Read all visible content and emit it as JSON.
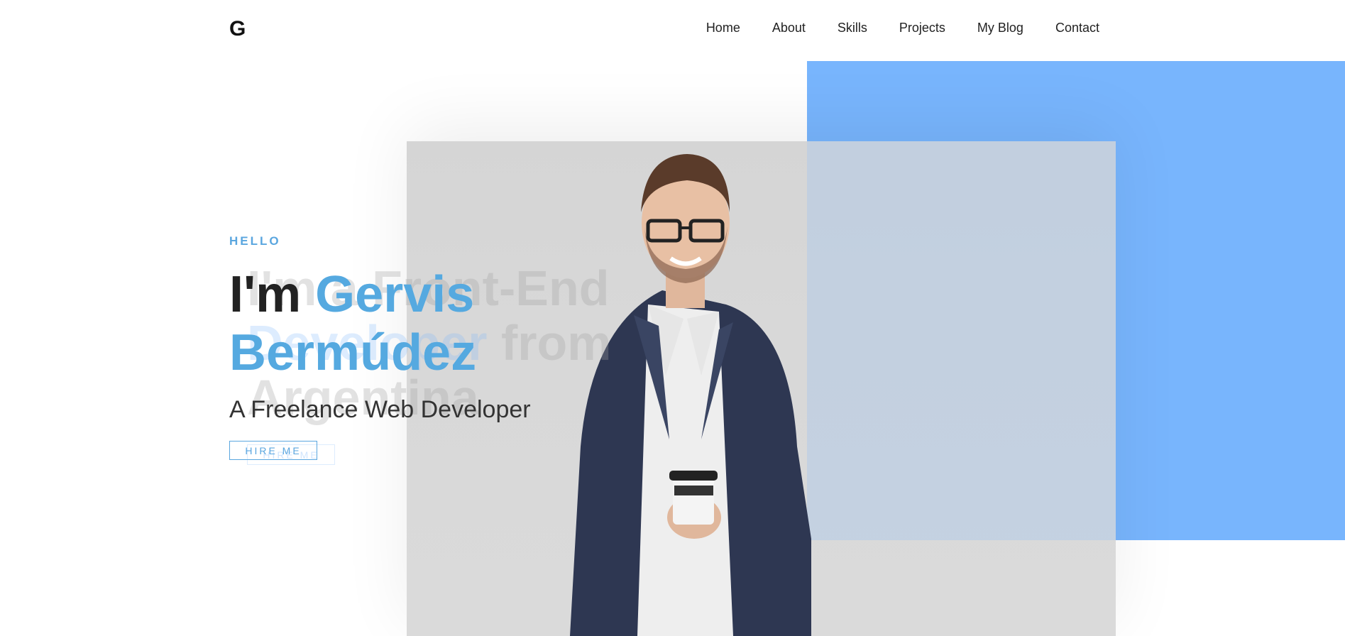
{
  "header": {
    "logo": "G",
    "nav": [
      "Home",
      "About",
      "Skills",
      "Projects",
      "My Blog",
      "Contact"
    ]
  },
  "hero": {
    "greeting": "HELLO",
    "headline_first": "I'm",
    "headline_name_1": "Gervis",
    "headline_name_2": "Bermúdez",
    "subtitle": "A Freelance Web Developer",
    "cta": "HIRE ME"
  },
  "ghost": {
    "line_1": "I'm a Front-End",
    "line_2_part_1": "Developer",
    "line_2_part_2": "from",
    "line_3": "Argentina",
    "cta": "HIRE ME"
  },
  "colors": {
    "accent": "#55a9e0",
    "blue_block": "#78b5fd"
  },
  "icons": {
    "photo": "person-photo"
  }
}
